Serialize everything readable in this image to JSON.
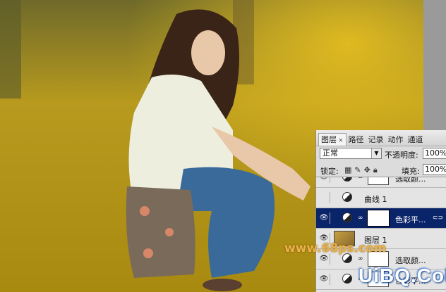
{
  "photo": {
    "description_icon": "photo-canvas-icon"
  },
  "panel": {
    "tabs": [
      {
        "label": "图层",
        "active": true
      },
      {
        "label": "路径"
      },
      {
        "label": "记录"
      },
      {
        "label": "动作"
      },
      {
        "label": "通道"
      }
    ],
    "close_glyph": "×",
    "blend_mode": "正常",
    "opacity_label": "不透明度:",
    "opacity_value": "100%",
    "lock_label": "锁定:",
    "fill_label": "填充:",
    "fill_value": "100%",
    "layers": [
      {
        "name": "选取颜...",
        "type": "adjustment",
        "selected": false,
        "visible": true
      },
      {
        "name": "曲线 1",
        "type": "adjustment-plain",
        "selected": false,
        "visible": false
      },
      {
        "name": "色彩平...",
        "type": "adjustment",
        "selected": true,
        "visible": true
      },
      {
        "name": "图层 1",
        "type": "photo",
        "selected": false,
        "visible": true
      },
      {
        "name": "选取颜...",
        "type": "adjustment",
        "selected": false,
        "visible": true
      },
      {
        "name": "色彩平...",
        "type": "adjustment",
        "selected": false,
        "visible": true
      }
    ]
  },
  "watermarks": {
    "site1": "www.68ps.com",
    "site2": "UiBQ.CoM"
  },
  "colors": {
    "selection": "#0a246a",
    "panel_bg": "#dcdcdc"
  }
}
